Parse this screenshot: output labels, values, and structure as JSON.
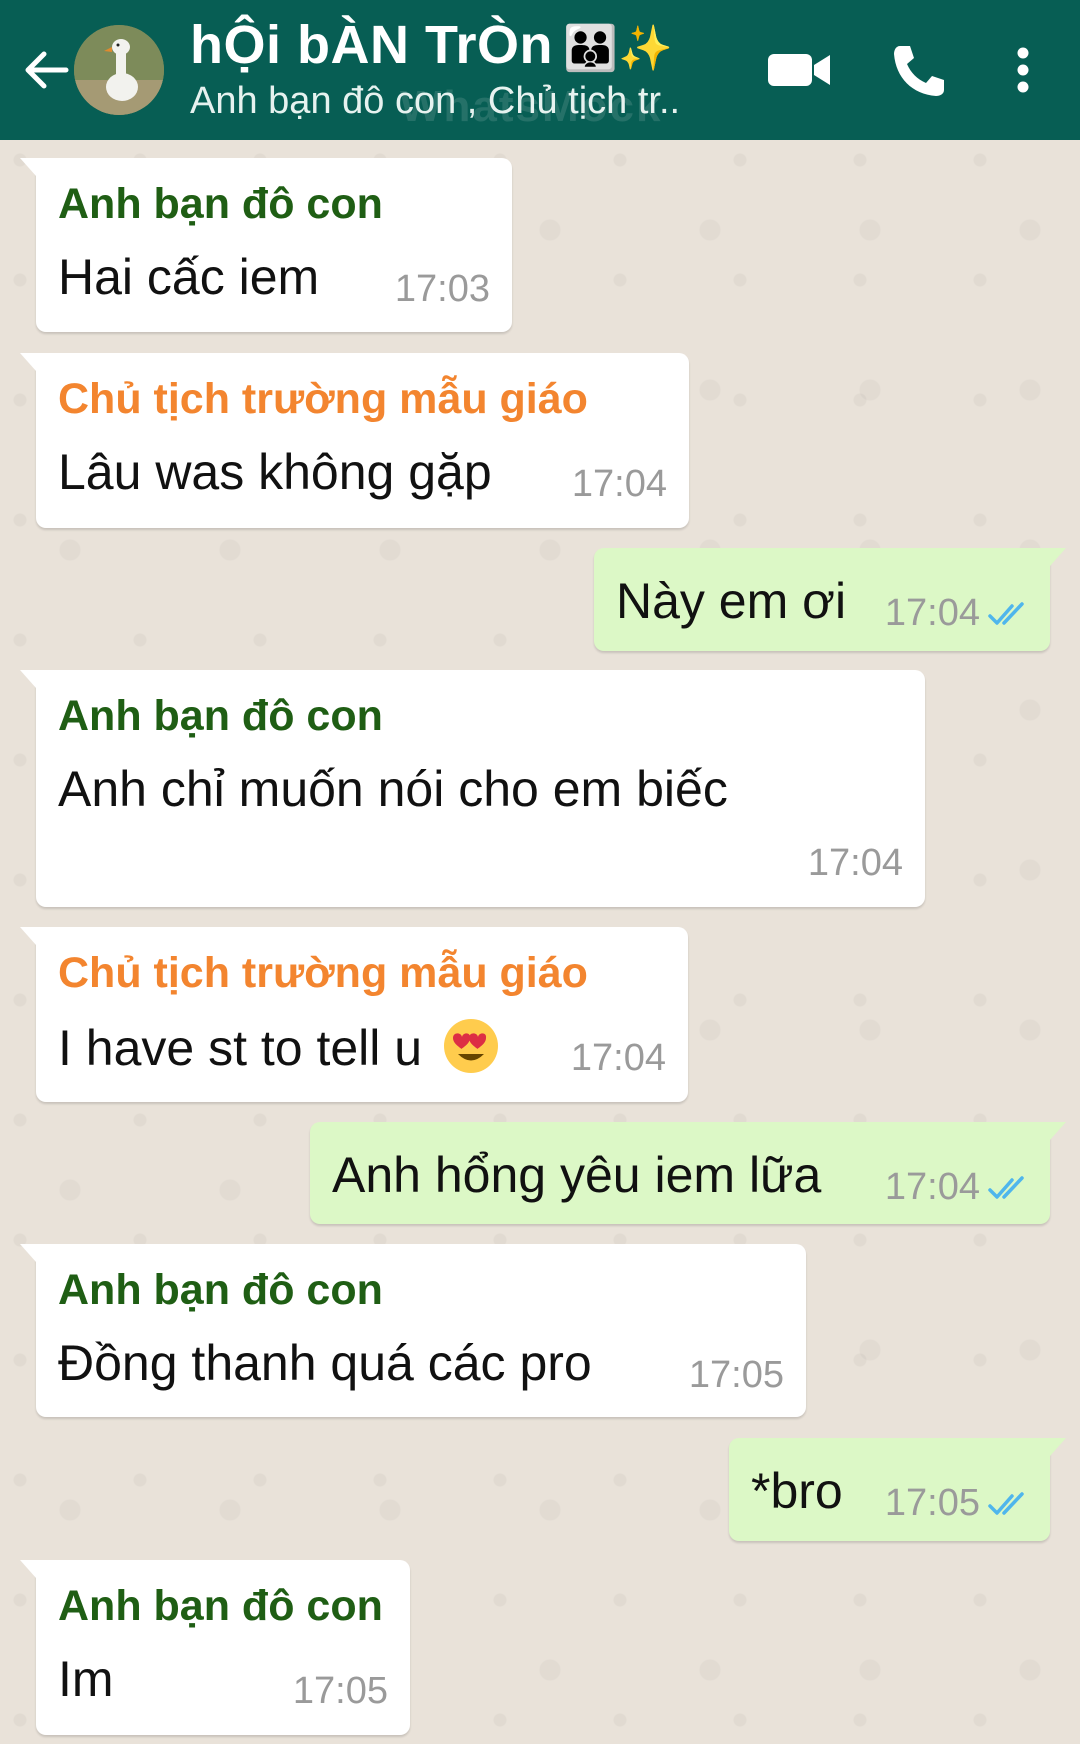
{
  "header": {
    "title": "hỘi bÀN TrÒn",
    "title_emoji": "👪✨",
    "subtitle": "Anh bạn đô con , Chủ tịch tr..",
    "watermark": "WhatsMock",
    "icons": [
      "back-arrow-icon",
      "video-call-icon",
      "phone-icon",
      "more-vert-icon"
    ],
    "bg_color": "#075e54"
  },
  "colors": {
    "incoming_bubble": "#ffffff",
    "outgoing_bubble": "#dcf8c6",
    "sender_green": "#1f5e14",
    "sender_orange": "#f3852f",
    "read_ticks": "#4fb6ec"
  },
  "messages": [
    {
      "direction": "in",
      "sender": "Anh bạn đô con",
      "text": "Hai cấc iem",
      "time": "17:03"
    },
    {
      "direction": "in",
      "sender": "Chủ tịch trường mẫu giáo",
      "text": "Lâu was không gặp",
      "time": "17:04"
    },
    {
      "direction": "out",
      "text": "Này em ơi",
      "time": "17:04",
      "status": "read"
    },
    {
      "direction": "in",
      "sender": "Anh bạn đô con",
      "text": "Anh chỉ muốn nói cho em biếc",
      "time": "17:04"
    },
    {
      "direction": "in",
      "sender": "Chủ tịch trường mẫu giáo",
      "text": "I have st to tell u",
      "emoji": "😍",
      "time": "17:04"
    },
    {
      "direction": "out",
      "text": "Anh hổng yêu iem lữa",
      "time": "17:04",
      "status": "read"
    },
    {
      "direction": "in",
      "sender": "Anh bạn đô con",
      "text": "Đồng thanh quá các pro",
      "time": "17:05"
    },
    {
      "direction": "out",
      "text": "*bro",
      "time": "17:05",
      "status": "read"
    },
    {
      "direction": "in",
      "sender": "Anh bạn đô con",
      "text": "Im",
      "time": "17:05"
    }
  ]
}
